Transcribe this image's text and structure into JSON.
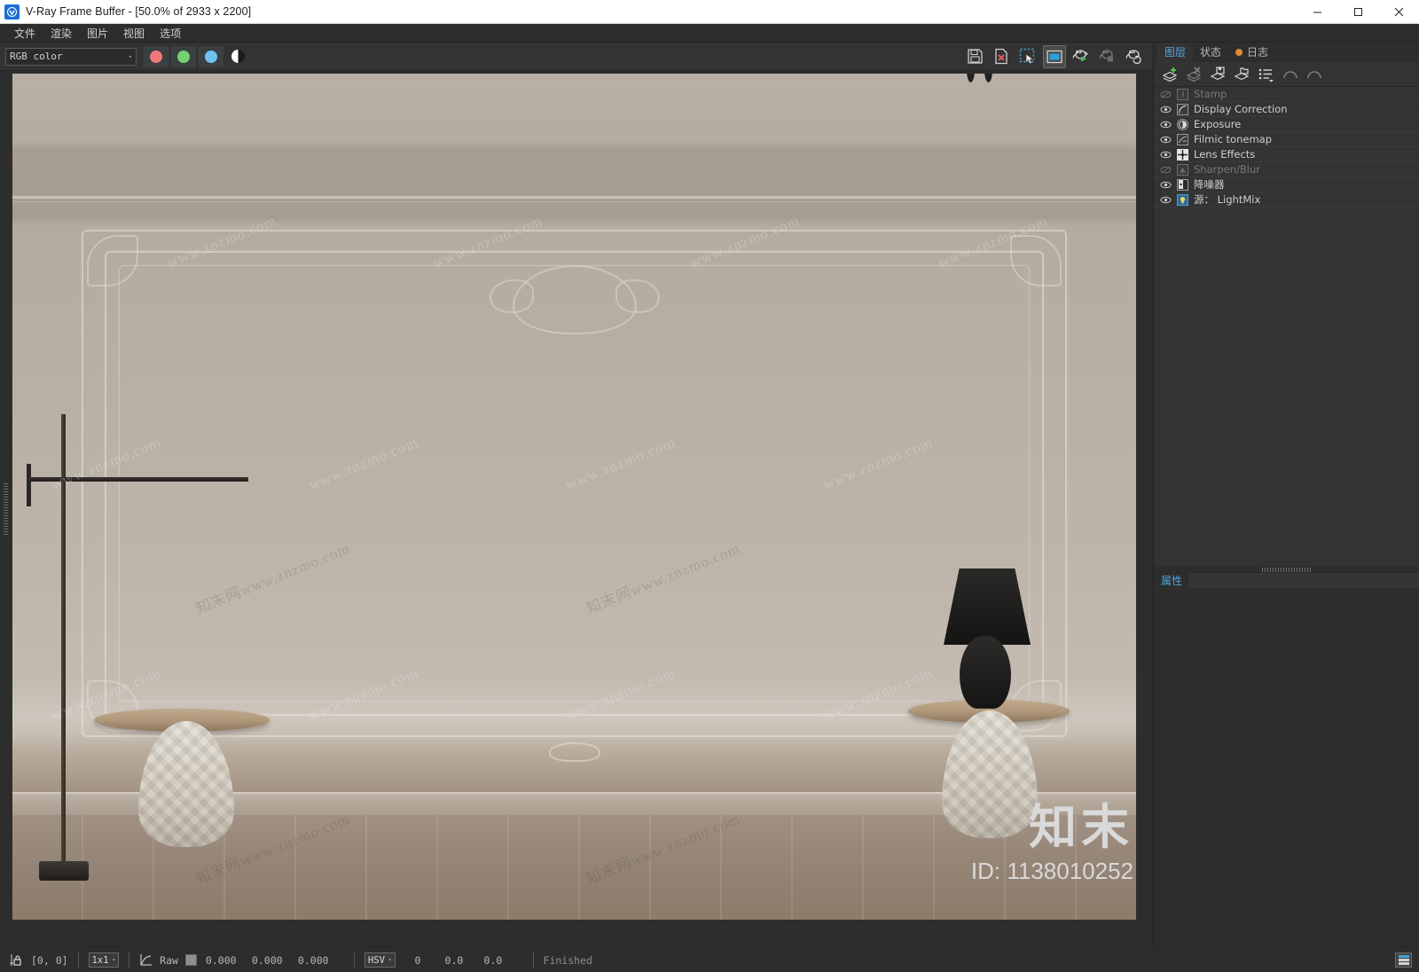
{
  "window": {
    "icon": "vray-logo-icon",
    "title": "V-Ray Frame Buffer - [50.0% of 2933 x 2200]",
    "minimize": "—",
    "maximize": "☐",
    "close": "✕"
  },
  "menubar": {
    "items": [
      {
        "label": "文件",
        "name": "menu-file"
      },
      {
        "label": "渲染",
        "name": "menu-render"
      },
      {
        "label": "图片",
        "name": "menu-image"
      },
      {
        "label": "视图",
        "name": "menu-view"
      },
      {
        "label": "选项",
        "name": "menu-options"
      }
    ]
  },
  "toolbar": {
    "channel_select": {
      "value": "RGB color",
      "arrow": "▾"
    },
    "channels": [
      {
        "name": "red-channel-button",
        "color": "#f07878"
      },
      {
        "name": "green-channel-button",
        "color": "#71d471"
      },
      {
        "name": "blue-channel-button",
        "color": "#6fc4ef"
      }
    ],
    "alpha_button": "alpha-channel-button",
    "right_icons": [
      {
        "name": "save-image-icon",
        "title": "Save image"
      },
      {
        "name": "clear-image-icon",
        "title": "Clear image"
      },
      {
        "name": "region-render-icon",
        "title": "Render region",
        "selected": false
      },
      {
        "name": "view-mode-icon",
        "title": "View mode",
        "selected": true
      },
      {
        "name": "start-render-icon",
        "title": "Start render"
      },
      {
        "name": "stop-render-icon",
        "title": "Stop render"
      },
      {
        "name": "render-last-icon",
        "title": "Render last"
      }
    ]
  },
  "render": {
    "resolution": "2933 x 2200",
    "zoom": "50.0%",
    "watermarks": [
      "www.znzmo.com",
      "www.znzmo.com",
      "www.znzmo.com",
      "www.znzmo.com",
      "www.znzmo.com",
      "www.znzmo.com",
      "www.znzmo.com",
      "www.znzmo.com",
      "www.znzmo.com",
      "www.znzmo.com",
      "www.znzmo.com",
      "www.znzmo.com",
      "知末网www.znzmo.com",
      "知末网www.znzmo.com",
      "知末网www.znzmo.com",
      "知末网www.znzmo.com"
    ],
    "brand": "知末",
    "brand_id": "ID: 1138010252"
  },
  "right_panel": {
    "tabs": [
      {
        "label": "图层",
        "name": "tab-layers",
        "active": true
      },
      {
        "label": "状态",
        "name": "tab-status",
        "active": false
      },
      {
        "label": "日志",
        "name": "tab-log",
        "active": false,
        "dot": true
      }
    ],
    "toolbar_icons": [
      {
        "name": "add-layer-icon"
      },
      {
        "name": "delete-layer-icon"
      },
      {
        "name": "save-layers-icon"
      },
      {
        "name": "load-layers-icon"
      },
      {
        "name": "layer-presets-icon"
      },
      {
        "name": "undo-icon"
      },
      {
        "name": "redo-icon"
      }
    ],
    "layers": [
      {
        "label": "Stamp",
        "visible": false,
        "enabled": false,
        "icon": "stamp-icon"
      },
      {
        "label": "Display Correction",
        "visible": true,
        "enabled": true,
        "icon": "curve-icon"
      },
      {
        "label": "Exposure",
        "visible": true,
        "enabled": true,
        "icon": "exposure-icon"
      },
      {
        "label": "Filmic tonemap",
        "visible": true,
        "enabled": true,
        "icon": "filmic-icon"
      },
      {
        "label": "Lens Effects",
        "visible": true,
        "enabled": true,
        "icon": "lens-icon"
      },
      {
        "label": "Sharpen/Blur",
        "visible": false,
        "enabled": false,
        "icon": "sharpen-icon"
      },
      {
        "label": "降噪器",
        "visible": true,
        "enabled": true,
        "icon": "denoiser-icon"
      },
      {
        "label": "源： LightMix",
        "visible": true,
        "enabled": true,
        "icon": "lightmix-icon"
      }
    ],
    "properties": {
      "label": "属性"
    }
  },
  "statusbar": {
    "lock_icon": "lock-pixel-icon",
    "coords": "[0,  0]",
    "sample_size": {
      "value": "1x1",
      "arrow": "▾"
    },
    "curve_icon": "curve-icon",
    "raw_label": "Raw",
    "rgb": [
      "0.000",
      "0.000",
      "0.000"
    ],
    "color_mode": {
      "value": "HSV",
      "arrow": "▾"
    },
    "hsv": [
      "0",
      "0.0",
      "0.0"
    ],
    "state": "Finished",
    "list_icon": "history-list-icon"
  }
}
